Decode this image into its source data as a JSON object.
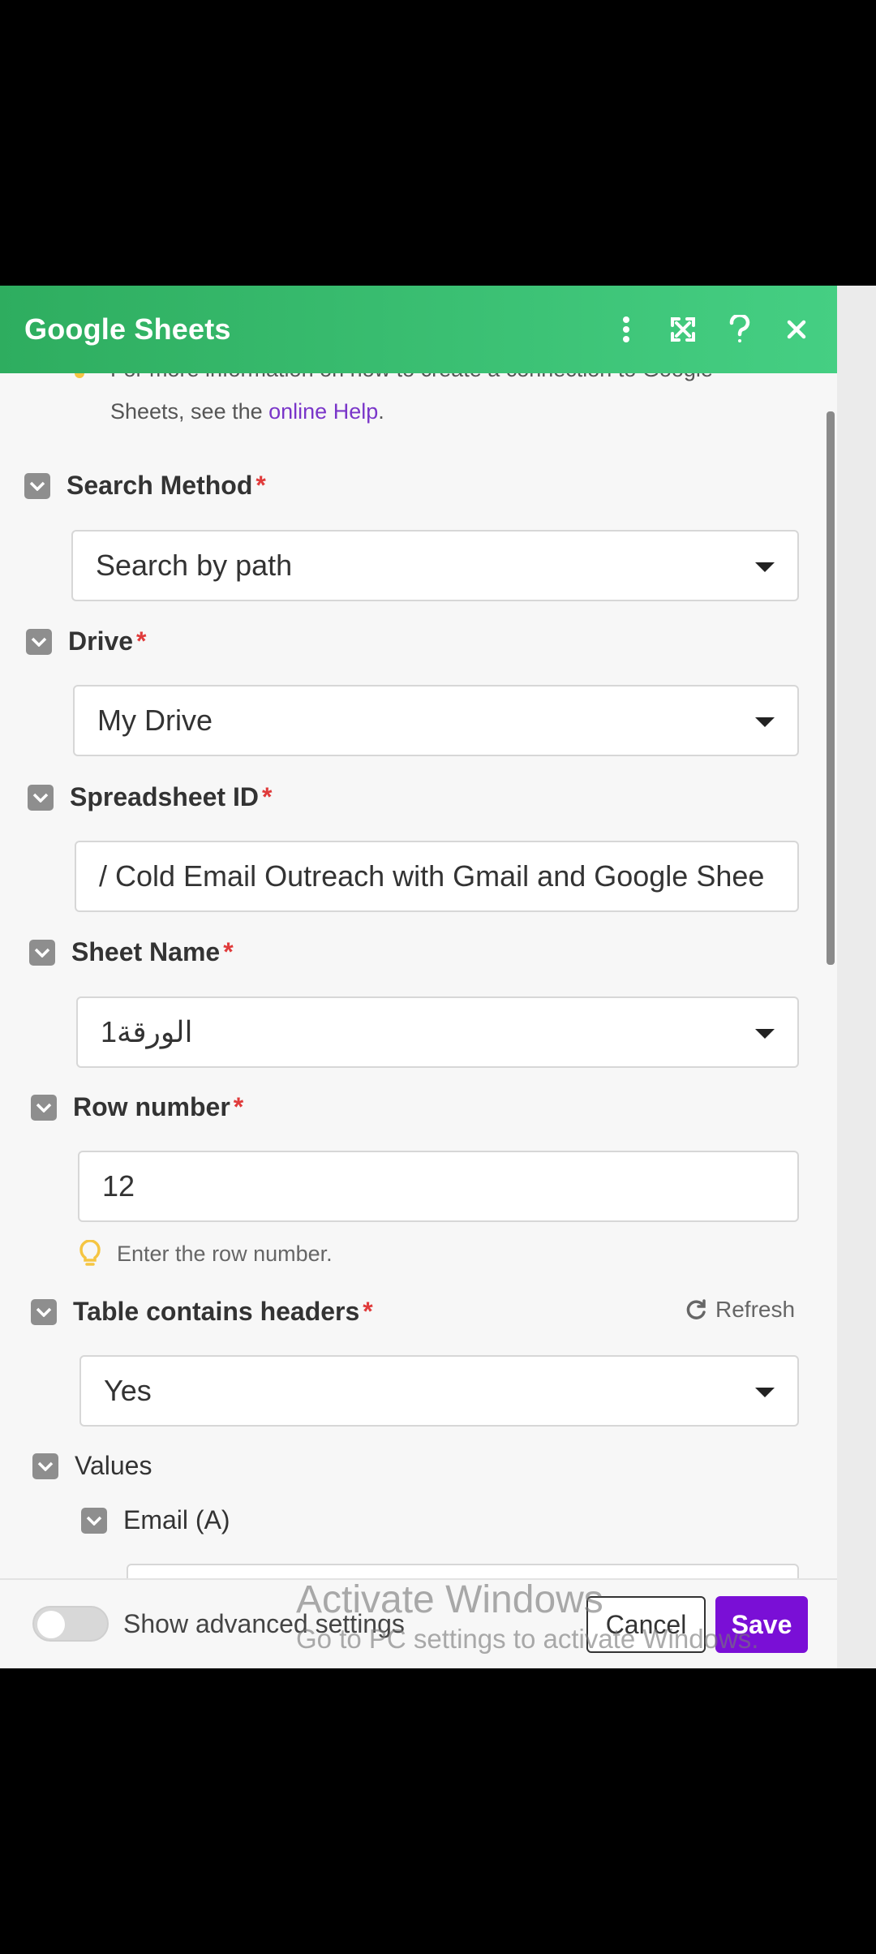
{
  "header": {
    "title": "Google Sheets"
  },
  "help": {
    "cut_text": "For more information on how to create a connection to Google",
    "prefix": "Sheets, see the ",
    "link": "online Help",
    "suffix": "."
  },
  "fields": {
    "search_method": {
      "label": "Search Method",
      "required": "*",
      "value": "Search by path"
    },
    "drive": {
      "label": "Drive",
      "required": "*",
      "value": "My Drive"
    },
    "spreadsheet_id": {
      "label": "Spreadsheet ID",
      "required": "*",
      "value": "/ Cold Email Outreach with Gmail and Google Shee"
    },
    "sheet_name": {
      "label": "Sheet Name",
      "required": "*",
      "value": "الورقة1"
    },
    "row_number": {
      "label": "Row number",
      "required": "*",
      "value": "12",
      "hint": "Enter the row number."
    },
    "table_headers": {
      "label": "Table contains headers",
      "required": "*",
      "value": "Yes",
      "refresh": "Refresh"
    },
    "values": {
      "label": "Values"
    },
    "email": {
      "label": "Email (A)"
    }
  },
  "footer": {
    "advanced_label": "Show advanced settings",
    "advanced_enabled": false,
    "cancel": "Cancel",
    "save": "Save"
  },
  "watermark": {
    "line1": "Activate Windows",
    "line2": "Go to PC settings to activate Windows."
  },
  "colors": {
    "header_start": "#2ead5f",
    "header_end": "#45cf83",
    "save": "#7a0fd6",
    "link": "#7a36c9",
    "required": "#e03b3b"
  }
}
